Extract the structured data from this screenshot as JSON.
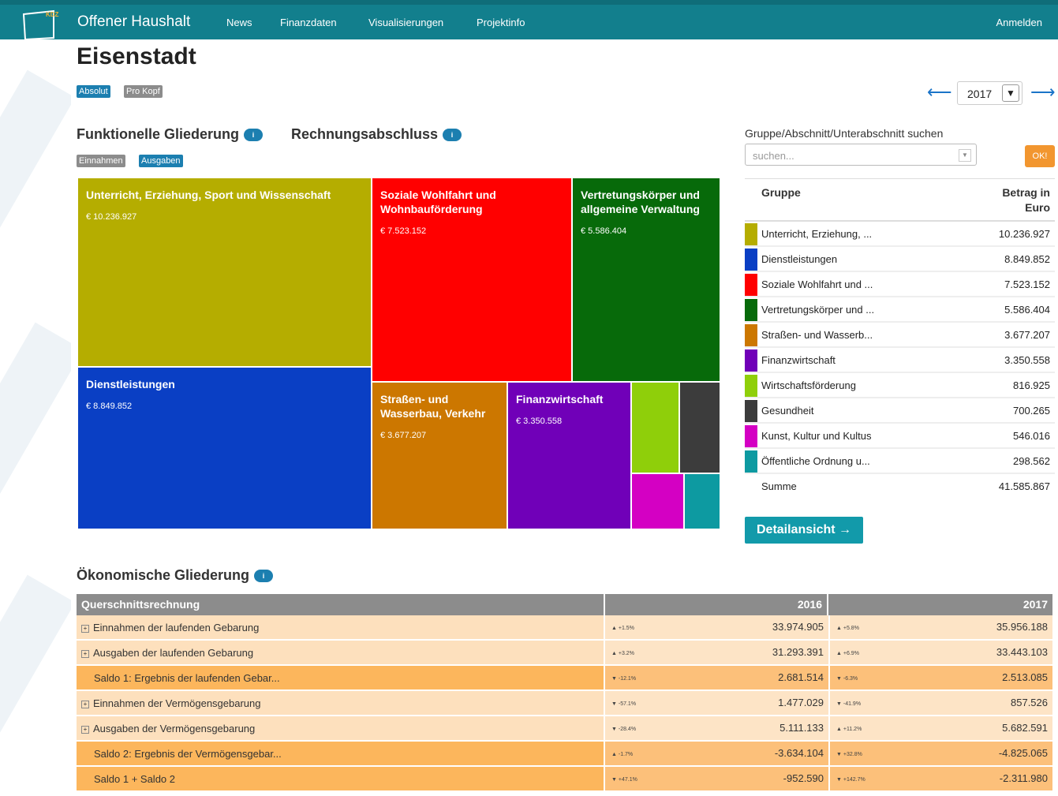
{
  "nav": {
    "brand": "Offener Haushalt",
    "items": [
      "News",
      "Finanzdaten",
      "Visualisierungen",
      "Projektinfo"
    ],
    "login": "Anmelden",
    "logo_letters": "KDZ"
  },
  "page": {
    "title": "Eisenstadt",
    "toggle_absolut": "Absolut",
    "toggle_prokopf": "Pro Kopf",
    "year": "2017",
    "arrow_prev": "⟵",
    "arrow_next": "⟶"
  },
  "functional": {
    "heading": "Funktionelle Gliederung",
    "heading2": "Rechnungsabschluss",
    "info_badge": "i",
    "toggle_einnahmen": "Einnahmen",
    "toggle_ausgaben": "Ausgaben",
    "tiles": [
      {
        "name": "Unterricht, Erziehung, Sport und Wissenschaft",
        "value": "€ 10.236.927",
        "color": "#b5ad00"
      },
      {
        "name": "Dienstleistungen",
        "value": "€ 8.849.852",
        "color": "#0a3fc4"
      },
      {
        "name": "Soziale Wohlfahrt und Wohnbauförderung",
        "value": "€ 7.523.152",
        "color": "#ff0000"
      },
      {
        "name": "Vertretungskörper und allgemeine Verwaltung",
        "value": "€ 5.586.404",
        "color": "#076a0a"
      },
      {
        "name": "Straßen- und Wasserbau, Verkehr",
        "value": "€ 3.677.207",
        "color": "#cc7700"
      },
      {
        "name": "Finanzwirtschaft",
        "value": "€ 3.350.558",
        "color": "#7000b8"
      },
      {
        "name": "",
        "value": "",
        "color": "#8fcf0a"
      },
      {
        "name": "",
        "value": "",
        "color": "#3c3c3c"
      },
      {
        "name": "",
        "value": "",
        "color": "#d400c3"
      },
      {
        "name": "",
        "value": "",
        "color": "#0d9aa1"
      }
    ]
  },
  "search": {
    "label": "Gruppe/Abschnitt/Unterabschnitt suchen",
    "placeholder": "suchen...",
    "ok": "OK!"
  },
  "groups": {
    "col_name": "Gruppe",
    "col_amount_1": "Betrag in",
    "col_amount_2": "Euro",
    "rows": [
      {
        "name": "Unterricht, Erziehung, ...",
        "amount": "10.236.927",
        "color": "#b5ad00"
      },
      {
        "name": "Dienstleistungen",
        "amount": "8.849.852",
        "color": "#0a3fc4"
      },
      {
        "name": "Soziale Wohlfahrt und ...",
        "amount": "7.523.152",
        "color": "#ff0000"
      },
      {
        "name": "Vertretungskörper und ...",
        "amount": "5.586.404",
        "color": "#076a0a"
      },
      {
        "name": "Straßen- und Wasserb...",
        "amount": "3.677.207",
        "color": "#cc7700"
      },
      {
        "name": "Finanzwirtschaft",
        "amount": "3.350.558",
        "color": "#7000b8"
      },
      {
        "name": "Wirtschaftsförderung",
        "amount": "816.925",
        "color": "#8fcf0a"
      },
      {
        "name": "Gesundheit",
        "amount": "700.265",
        "color": "#3c3c3c"
      },
      {
        "name": "Kunst, Kultur und Kultus",
        "amount": "546.016",
        "color": "#d400c3"
      },
      {
        "name": "Öffentliche Ordnung u...",
        "amount": "298.562",
        "color": "#0d9aa1"
      }
    ],
    "sum_label": "Summe",
    "sum_amount": "41.585.867",
    "detail_button": "Detailansicht →"
  },
  "economic": {
    "heading": "Ökonomische Gliederung",
    "col_label": "Querschnittsrechnung",
    "col_2016": "2016",
    "col_2017": "2017",
    "rows": [
      {
        "label": "Einnahmen der laufenden Gebarung",
        "expandable": true,
        "saldo": false,
        "t2016": "▲ +1.5%",
        "v2016": "33.974.905",
        "t2017": "▲ +5.8%",
        "v2017": "35.956.188"
      },
      {
        "label": "Ausgaben der laufenden Gebarung",
        "expandable": true,
        "saldo": false,
        "t2016": "▲ +3.2%",
        "v2016": "31.293.391",
        "t2017": "▲ +6.9%",
        "v2017": "33.443.103"
      },
      {
        "label": "Saldo 1: Ergebnis der laufenden Gebar...",
        "expandable": false,
        "saldo": true,
        "t2016": "▼ -12.1%",
        "v2016": "2.681.514",
        "t2017": "▼ -6.3%",
        "v2017": "2.513.085"
      },
      {
        "label": "Einnahmen der Vermögensgebarung",
        "expandable": true,
        "saldo": false,
        "t2016": "▼ -57.1%",
        "v2016": "1.477.029",
        "t2017": "▼ -41.9%",
        "v2017": "857.526"
      },
      {
        "label": "Ausgaben der Vermögensgebarung",
        "expandable": true,
        "saldo": false,
        "t2016": "▼ -28.4%",
        "v2016": "5.111.133",
        "t2017": "▲ +11.2%",
        "v2017": "5.682.591"
      },
      {
        "label": "Saldo 2: Ergebnis der Vermögensgebar...",
        "expandable": false,
        "saldo": true,
        "t2016": "▲ -1.7%",
        "v2016": "-3.634.104",
        "t2017": "▼ +32.8%",
        "v2017": "-4.825.065"
      },
      {
        "label": "Saldo 1 + Saldo 2",
        "expandable": false,
        "saldo": true,
        "t2016": "▼ +47.1%",
        "v2016": "-952.590",
        "t2017": "▼ +142.7%",
        "v2017": "-2.311.980"
      }
    ]
  }
}
